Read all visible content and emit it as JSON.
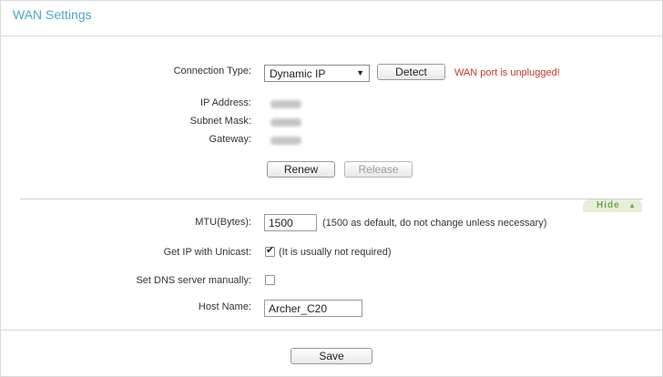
{
  "page": {
    "title": "WAN Settings"
  },
  "connection": {
    "type_label": "Connection Type:",
    "type_value": "Dynamic IP",
    "detect_button": "Detect",
    "warning": "WAN port is unplugged!"
  },
  "status": {
    "ip_label": "IP Address:",
    "subnet_label": "Subnet Mask:",
    "gateway_label": "Gateway:"
  },
  "actions": {
    "renew": "Renew",
    "release": "Release"
  },
  "advanced": {
    "toggle": "Hide",
    "mtu_label": "MTU(Bytes):",
    "mtu_value": "1500",
    "mtu_note": "(1500 as default, do not change unless necessary)",
    "unicast_label": "Get IP with Unicast:",
    "unicast_checked": true,
    "unicast_note": "(It is usually not required)",
    "dns_label": "Set DNS server manually:",
    "dns_checked": false,
    "host_label": "Host Name:",
    "host_value": "Archer_C20"
  },
  "footer": {
    "save": "Save"
  },
  "colors": {
    "title": "#4aa7c4",
    "warning": "#c0392b",
    "toggle": "#6aa84f"
  }
}
